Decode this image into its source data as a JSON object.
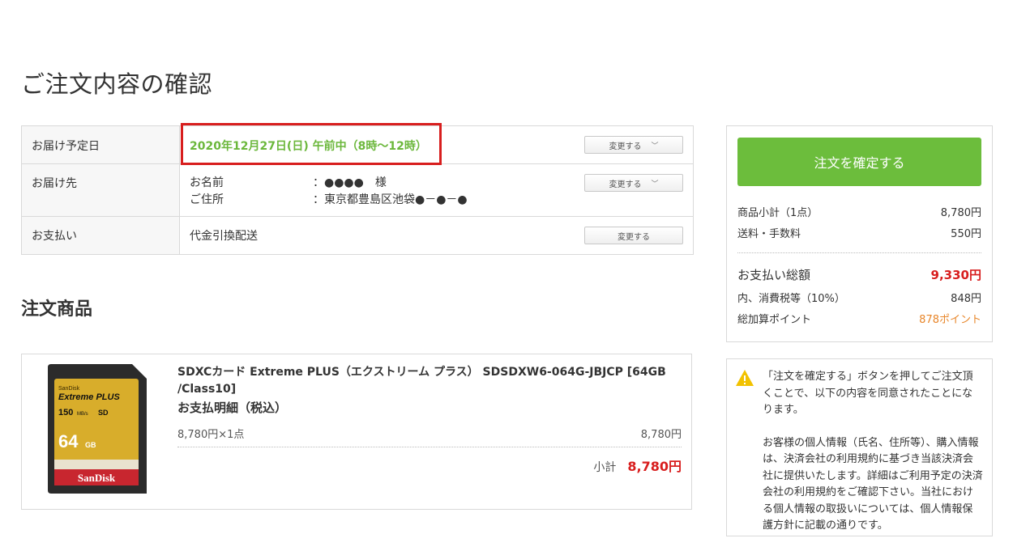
{
  "page": {
    "title": "ご注文内容の確認",
    "products_heading": "注文商品"
  },
  "delivery_info": {
    "date": {
      "label": "お届け予定日",
      "value": "2020年12月27日(日) 午前中（8時～12時）",
      "change_label": "変更する"
    },
    "destination": {
      "label": "お届け先",
      "name_key": "お名前",
      "name_value": "：●●●●　様",
      "address_key": "ご住所",
      "address_value": "：東京都豊島区池袋●－●－●",
      "change_label": "変更する"
    },
    "payment": {
      "label": "お支払い",
      "value": "代金引換配送",
      "change_label": "変更する"
    }
  },
  "product": {
    "name": "SDXCカード Extreme PLUS（エクストリーム プラス） SDSDXW6-064G-JBJCP [64GB /Class10]",
    "breakdown_title": "お支払明細（税込）",
    "unit_line": "8,780円×1点",
    "unit_total": "8,780円",
    "subtotal_label": "小計",
    "subtotal_value": "8,780円",
    "card": {
      "brand": "SanDisk",
      "line": "Extreme PLUS",
      "speed": "150",
      "speed_unit": "MB/s",
      "capacity": "64",
      "capacity_unit": "GB",
      "logo": "SanDisk"
    }
  },
  "summary": {
    "confirm_button": "注文を確定する",
    "items_label": "商品小計（1点）",
    "items_value": "8,780円",
    "shipping_label": "送料・手数料",
    "shipping_value": "550円",
    "total_label": "お支払い総額",
    "total_value": "9,330円",
    "tax_label": "内、消費税等（10%）",
    "tax_value": "848円",
    "points_label": "総加算ポイント",
    "points_value": "878ポイント"
  },
  "notice": {
    "icon": "warning-icon",
    "paragraph1": "「注文を確定する」ボタンを押してご注文頂くことで、以下の内容を同意されたことになります。",
    "paragraph2": "お客様の個人情報（氏名、住所等）、購入情報は、決済会社の利用規約に基づき当該決済会社に提供いたします。詳細はご利用予定の決済会社の利用規約をご確認下さい。当社における個人情報の取扱いについては、個人情報保護方針に記載の通りです。"
  },
  "colors": {
    "accent_green": "#6cbd3c",
    "price_red": "#d81e1e",
    "points_orange": "#e8862a",
    "highlight_red": "#d81e1e"
  }
}
